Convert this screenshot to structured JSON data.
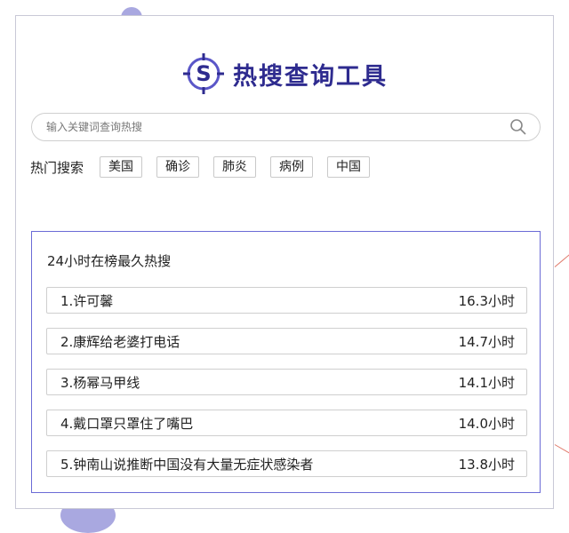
{
  "brand": {
    "title": "热搜查询工具",
    "logo_letter": "S",
    "accent_color": "#2e2b8f",
    "logo_color": "#5a56c8"
  },
  "search": {
    "placeholder": "输入关键词查询热搜",
    "value": "",
    "icon": "search-icon"
  },
  "hot_search": {
    "label": "热门搜索",
    "tags": [
      "美国",
      "确诊",
      "肺炎",
      "病例",
      "中国"
    ]
  },
  "ranking": {
    "title": "24小时在榜最久热搜",
    "items": [
      {
        "label": "1.许可馨",
        "duration": "16.3小时"
      },
      {
        "label": "2.康辉给老婆打电话",
        "duration": "14.7小时"
      },
      {
        "label": "3.杨幂马甲线",
        "duration": "14.1小时"
      },
      {
        "label": "4.戴口罩只罩住了嘴巴",
        "duration": "14.0小时"
      },
      {
        "label": "5.钟南山说推断中国没有大量无症状感染者",
        "duration": "13.8小时"
      }
    ]
  },
  "colors": {
    "panel_border": "#6b6bd6",
    "decor_circle": "#a9a8e0",
    "decor_line": "#e07a6b"
  }
}
